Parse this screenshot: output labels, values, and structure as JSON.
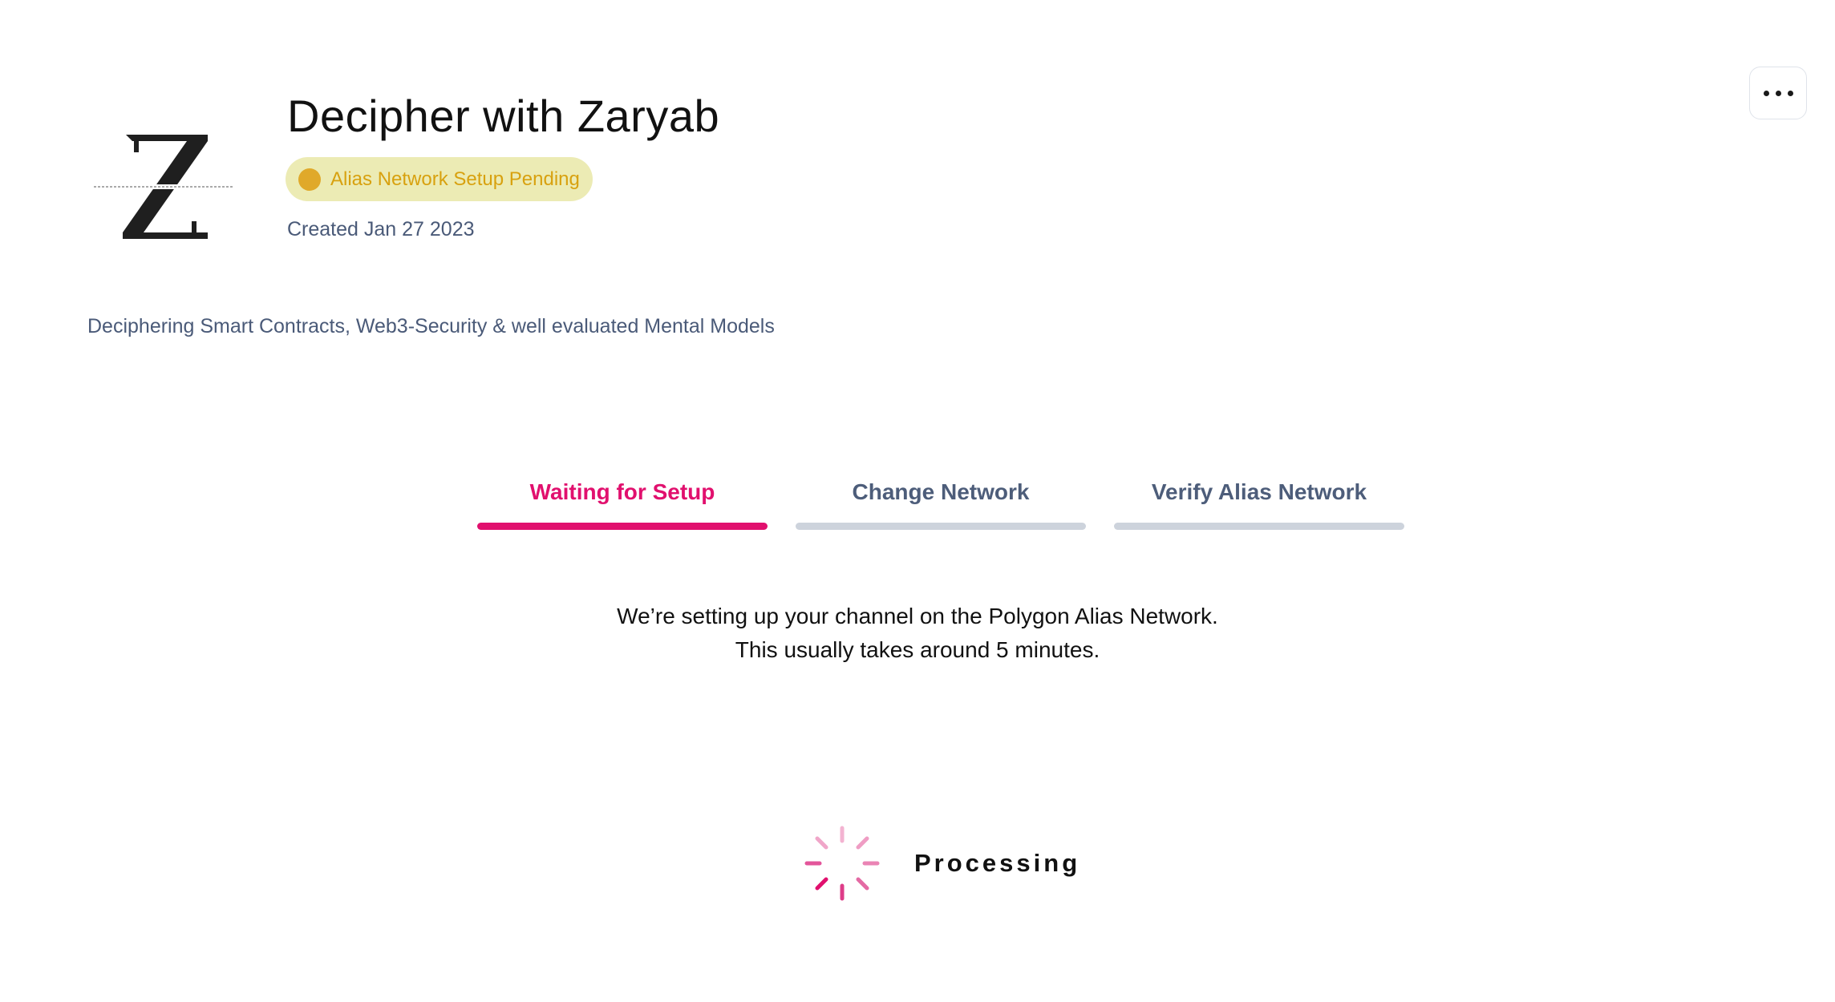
{
  "channel": {
    "logo_icon": "channel-logo-z-icon",
    "name": "Decipher with Zaryab",
    "status_badge": "Alias Network Setup Pending",
    "created": "Created Jan 27 2023",
    "description": "Deciphering Smart Contracts, Web3-Security & well evaluated Mental Models"
  },
  "menu": {
    "more_icon": "more-horizontal-icon"
  },
  "steps": [
    {
      "label": "Waiting for Setup",
      "active": true
    },
    {
      "label": "Change Network",
      "active": false
    },
    {
      "label": "Verify Alias Network",
      "active": false
    }
  ],
  "message": {
    "line1": "We’re setting up your channel on the Polygon Alias Network.",
    "line2": "This usually takes around 5 minutes."
  },
  "processing": {
    "label": "Processing",
    "icon": "spinner-icon"
  },
  "colors": {
    "accent": "#e1106e",
    "badge_bg": "#ecebb4",
    "badge_text": "#d8a10f",
    "muted_text": "#4a5a78",
    "inactive_bar": "#cdd3dc"
  }
}
